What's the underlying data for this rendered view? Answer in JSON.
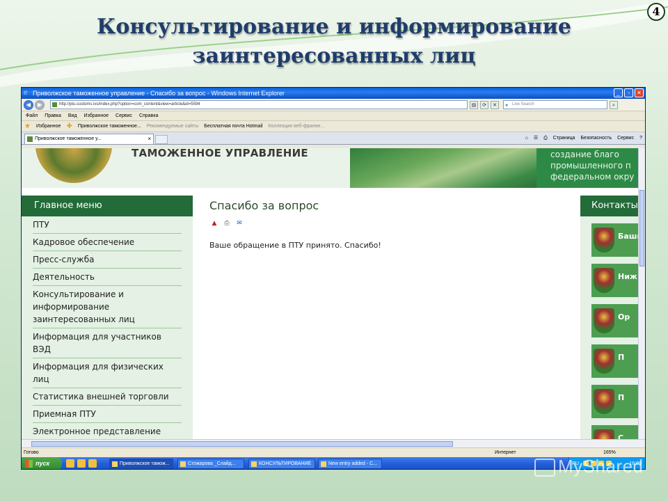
{
  "slide": {
    "title_line1": "Консультирование и информирование",
    "title_line2": "заинтересованных лиц",
    "number": "4"
  },
  "browser": {
    "window_title": "Приволжское таможенное управление - Спасибо за вопрос - Windows Internet Explorer",
    "url": "http://ptu.customs.ivs/index.php?option=com_content&view=article&id=5594",
    "search_placeholder": "Live Search",
    "menu": [
      "Файл",
      "Правка",
      "Вид",
      "Избранное",
      "Сервис",
      "Справка"
    ],
    "favorites": {
      "label": "Избранное",
      "items": [
        "Приволжское таможенное...",
        "Рекомендуемые сайты",
        "Бесплатная почта Hotmail",
        "Коллекция веб-фрагме..."
      ]
    },
    "tab_title": "Приволжское таможенное у...",
    "commands": [
      "Страница",
      "Безопасность",
      "Сервис"
    ],
    "status": {
      "left": "Готово",
      "zone": "Интернет",
      "zoom": "165%"
    }
  },
  "site": {
    "header_name": "ТАМОЖЕННОЕ УПРАВЛЕНИЕ",
    "slogan": "создание благо\nпромышленного п\nфедеральном окру",
    "sidebar_title": "Главное меню",
    "menu_items": [
      "ПТУ",
      "Кадровое обеспечение",
      "Пресс-служба",
      "Деятельность",
      "Консультирование и информирование заинтересованных лиц",
      "Информация для участников ВЭД",
      "Информация для физических лиц",
      "Статистика внешней торговли",
      "Приемная ПТУ",
      "Электронное представление"
    ],
    "content_title": "Спасибо за вопрос",
    "content_message": "Ваше обращение в ПТУ принято. Спасибо!",
    "contacts_title": "Контакты",
    "contact_labels": [
      "Башк",
      "Ниж",
      "Ор",
      "П",
      "П",
      "С"
    ]
  },
  "taskbar": {
    "start": "пуск",
    "tasks": [
      "Приволжское тамож...",
      "Стожарова _Слайд...",
      "КОНСУЛЬТИРОВАНИЕ",
      "New entry added - C..."
    ],
    "language": "RU",
    "clock": "16:09"
  },
  "watermark": "MyShared",
  "colors": {
    "accent_green": "#236b38",
    "title_blue": "#1f3d6b"
  }
}
